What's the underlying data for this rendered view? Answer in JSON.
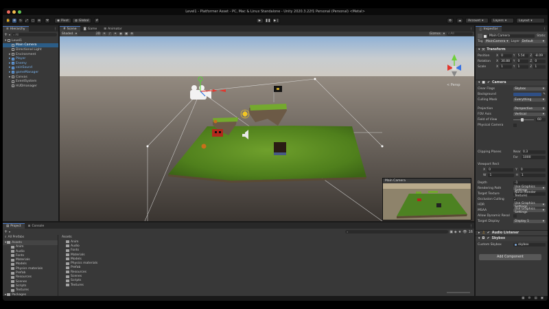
{
  "window": {
    "title": "Level1 - Platformer Asset - PC, Mac & Linux Standalone - Unity 2020.3.22f1 Personal (Personal) <Metal>"
  },
  "toolbar": {
    "pivot_label": "Pivot",
    "global_label": "Global",
    "account_label": "Account",
    "layers_label": "Layers",
    "layout_label": "Layout"
  },
  "hierarchy": {
    "tab": "Hierarchy",
    "search_placeholder": "All",
    "items": [
      {
        "label": "Level1",
        "depth": 0,
        "kind": "scene"
      },
      {
        "label": "Main Camera",
        "depth": 1,
        "kind": "selected"
      },
      {
        "label": "Directional Light",
        "depth": 1,
        "kind": "normal"
      },
      {
        "label": "Environment",
        "depth": 1,
        "kind": "normal"
      },
      {
        "label": "Player",
        "depth": 1,
        "kind": "prefab"
      },
      {
        "label": "Enemy",
        "depth": 1,
        "kind": "prefab"
      },
      {
        "label": "coinSound",
        "depth": 1,
        "kind": "prefab"
      },
      {
        "label": "gameManager",
        "depth": 1,
        "kind": "prefab"
      },
      {
        "label": "Canvas",
        "depth": 1,
        "kind": "normal"
      },
      {
        "label": "EventSystem",
        "depth": 1,
        "kind": "normal"
      },
      {
        "label": "HUDmanager",
        "depth": 1,
        "kind": "normal"
      }
    ]
  },
  "scene_view": {
    "tabs": [
      "Scene",
      "Game",
      "Animator"
    ],
    "shading": "Shaded",
    "mode_2d": "2D",
    "gizmos": "Gizmos",
    "search_placeholder": "All",
    "persp_label": "< Persp",
    "camera_preview_title": "Main Camera"
  },
  "inspector": {
    "tab": "Inspector",
    "object_name": "Main Camera",
    "static_label": "Static",
    "tag_label": "Tag",
    "tag_value": "MainCamera",
    "layer_label": "Layer",
    "layer_value": "Default",
    "transform": {
      "title": "Transform",
      "position": {
        "label": "Position",
        "x": "0",
        "y": "5.54",
        "z": "-8.09"
      },
      "rotation": {
        "label": "Rotation",
        "x": "30.88",
        "y": "0",
        "z": "0"
      },
      "scale": {
        "label": "Scale",
        "x": "1",
        "y": "1",
        "z": "1"
      }
    },
    "camera": {
      "title": "Camera",
      "rows": [
        {
          "label": "Clear Flags",
          "value": "Skybox",
          "type": "drop"
        },
        {
          "label": "Background",
          "value": "",
          "type": "color"
        },
        {
          "label": "Culling Mask",
          "value": "Everything",
          "type": "drop"
        },
        {
          "label": "Projection",
          "value": "Perspective",
          "type": "drop"
        },
        {
          "label": "FOV Axis",
          "value": "Vertical",
          "type": "drop"
        },
        {
          "label": "Field of View",
          "value": "60",
          "type": "slider"
        },
        {
          "label": "Physical Camera",
          "value": "",
          "type": "check"
        }
      ],
      "clipping_label": "Clipping Planes",
      "near_label": "Near",
      "near_value": "0.3",
      "far_label": "Far",
      "far_value": "1000",
      "viewport_label": "Viewport Rect",
      "vp_x": "0",
      "vp_y": "0",
      "vp_w": "1",
      "vp_h": "1",
      "rows2": [
        {
          "label": "Depth",
          "value": "-1",
          "type": "field"
        },
        {
          "label": "Rendering Path",
          "value": "Use Graphics Settings",
          "type": "drop"
        },
        {
          "label": "Target Texture",
          "value": "None (Render Texture)",
          "type": "field"
        },
        {
          "label": "Occlusion Culling",
          "value": "✔",
          "type": "check"
        },
        {
          "label": "HDR",
          "value": "Use Graphics Settings",
          "type": "drop"
        },
        {
          "label": "MSAA",
          "value": "Use Graphics Settings",
          "type": "drop"
        },
        {
          "label": "Allow Dynamic Resol",
          "value": "",
          "type": "check"
        },
        {
          "label": "Target Display",
          "value": "Display 1",
          "type": "drop"
        }
      ]
    },
    "audio_listener": "Audio Listener",
    "skybox": {
      "title": "Skybox",
      "field_label": "Custom Skybox",
      "field_value": "skybox"
    },
    "add_component": "Add Component"
  },
  "project": {
    "tabs": [
      "Project",
      "Console"
    ],
    "favorites_label": "All Prefabs",
    "assets_label": "Assets",
    "folders": [
      "Anim",
      "Audio",
      "Fonts",
      "Materials",
      "Models",
      "Physics materials",
      "Prefab",
      "Resources",
      "Scenes",
      "Scripts",
      "Textures"
    ],
    "packages_label": "Packages",
    "breadcrumb": "Assets",
    "asset_count": "16"
  },
  "colors": {
    "accent": "#2c5d87",
    "panel": "#383838",
    "background": "#191919",
    "prefab_blue": "#7bb4ee"
  }
}
